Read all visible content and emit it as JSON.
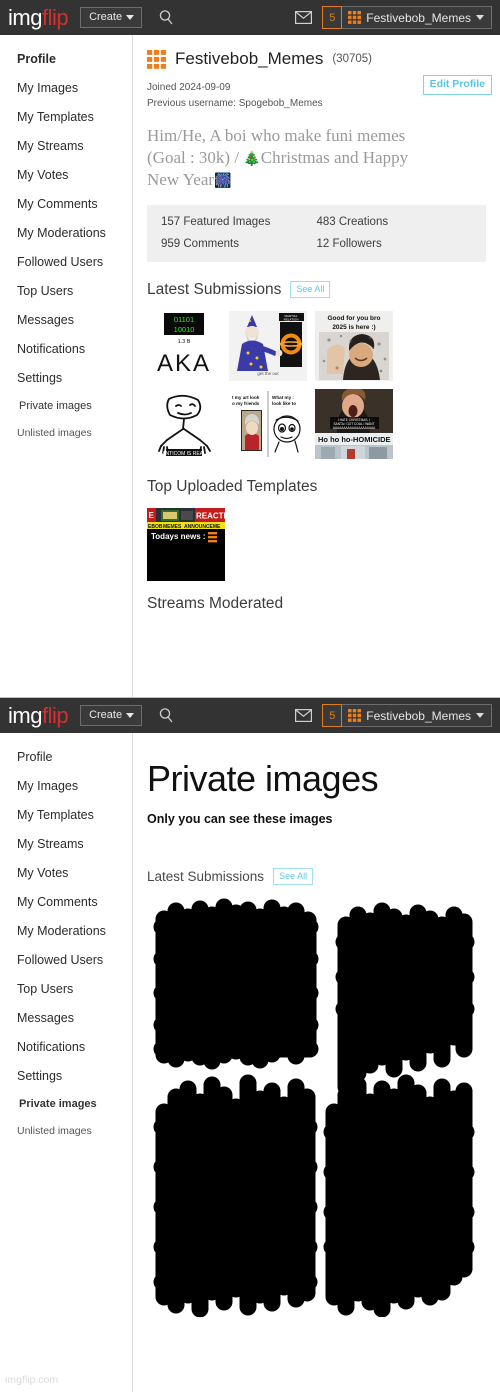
{
  "header": {
    "logo_img": "img",
    "logo_flip": "flip",
    "create_label": "Create",
    "search_icon": "search-icon",
    "mail_icon": "mail-icon",
    "notification_count": "5",
    "username": "Festivebob_Memes",
    "avatar_icon": "brick-avatar-icon",
    "caret_icon": "chevron-down-icon",
    "bg_color": "#333333",
    "accent_orange": "#e07b20",
    "logo_red": "#d32f2f"
  },
  "sidebar": {
    "items": [
      {
        "label": "Profile"
      },
      {
        "label": "My Images"
      },
      {
        "label": "My Templates"
      },
      {
        "label": "My Streams"
      },
      {
        "label": "My Votes"
      },
      {
        "label": "My Comments"
      },
      {
        "label": "My Moderations"
      },
      {
        "label": "Followed Users"
      },
      {
        "label": "Top Users"
      },
      {
        "label": "Messages"
      },
      {
        "label": "Notifications"
      },
      {
        "label": "Settings"
      },
      {
        "label": "Private images"
      },
      {
        "label": "Unlisted images"
      }
    ]
  },
  "profile": {
    "display_name": "Festivebob_Memes",
    "points": "(30705)",
    "joined": "Joined 2024-09-09",
    "previous_username": "Previous username: Spogebob_Memes",
    "edit_button": "Edit Profile",
    "bio_line1": "Him/He, A boi who make funi memes",
    "bio_line2_a": "(Goal : 30k) / ",
    "bio_tree_emoji": "🎄",
    "bio_line2_b": "Christmas and Happy",
    "bio_line3": "New Year",
    "bio_fireworks_emoji": "🎆",
    "stats": [
      "157 Featured Images",
      "483 Creations",
      "959 Comments",
      "12 Followers"
    ],
    "latest_submissions_title": "Latest Submissions",
    "see_all_label": "See All",
    "top_templates_title": "Top Uploaded Templates",
    "streams_moderated_title": "Streams Moderated"
  },
  "thumbnails": {
    "aka_caption": "1.3 B",
    "aka_text": "AKA",
    "wizard_caption": "get the out",
    "newyear_line1": "Good for you bro",
    "newyear_line2": "2025 is here :)",
    "anticom_caption": "ANTICOM IS REAL",
    "mozart_line1": "t my art look",
    "mozart_line2": "o my friends",
    "sketch_line1": "What my :",
    "sketch_line2": "look like to",
    "hohoho_caption": "Ho ho ho-HOMICIDE",
    "hohoho_overlay1": "I HATE CHRISTMAS, I",
    "hohoho_overlay2": "SANTA I GOT COAL I WANT",
    "hohoho_overlay3": "AAAAAAAAAAAAAAAAAAAA"
  },
  "template": {
    "banner_left": "E",
    "banner_right": "REACTIO",
    "strip1": "EBOB",
    "strip2": "MEMES",
    "strip3": "ANNOUNCEME",
    "headline": "Todays news :"
  },
  "private_page": {
    "title": "Private images",
    "subtitle": "Only you can see these images",
    "latest_submissions_title": "Latest Submissions",
    "see_all_label": "See All",
    "redacted_note": "redacted-thumbnails"
  },
  "footer": {
    "watermark": "imgflip.com"
  }
}
